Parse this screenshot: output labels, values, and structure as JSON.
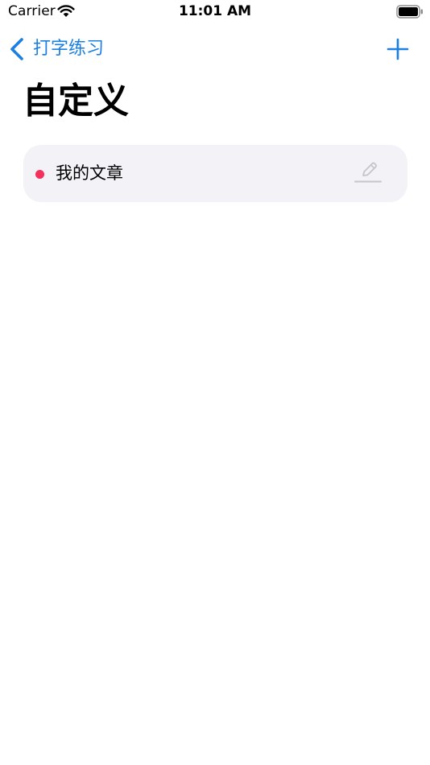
{
  "status_bar": {
    "carrier": "Carrier",
    "time": "11:01 AM",
    "icons": [
      "wifi-icon",
      "battery-icon"
    ]
  },
  "nav": {
    "back_label": "打字练习",
    "back_icon": "chevron-left-icon",
    "add_icon": "plus-icon",
    "accent_color": "#1b7fe3"
  },
  "page": {
    "title": "自定义"
  },
  "list": {
    "items": [
      {
        "title": "我的文章",
        "dot_color": "#f5305b",
        "action_icon": "pencil-icon"
      }
    ]
  }
}
